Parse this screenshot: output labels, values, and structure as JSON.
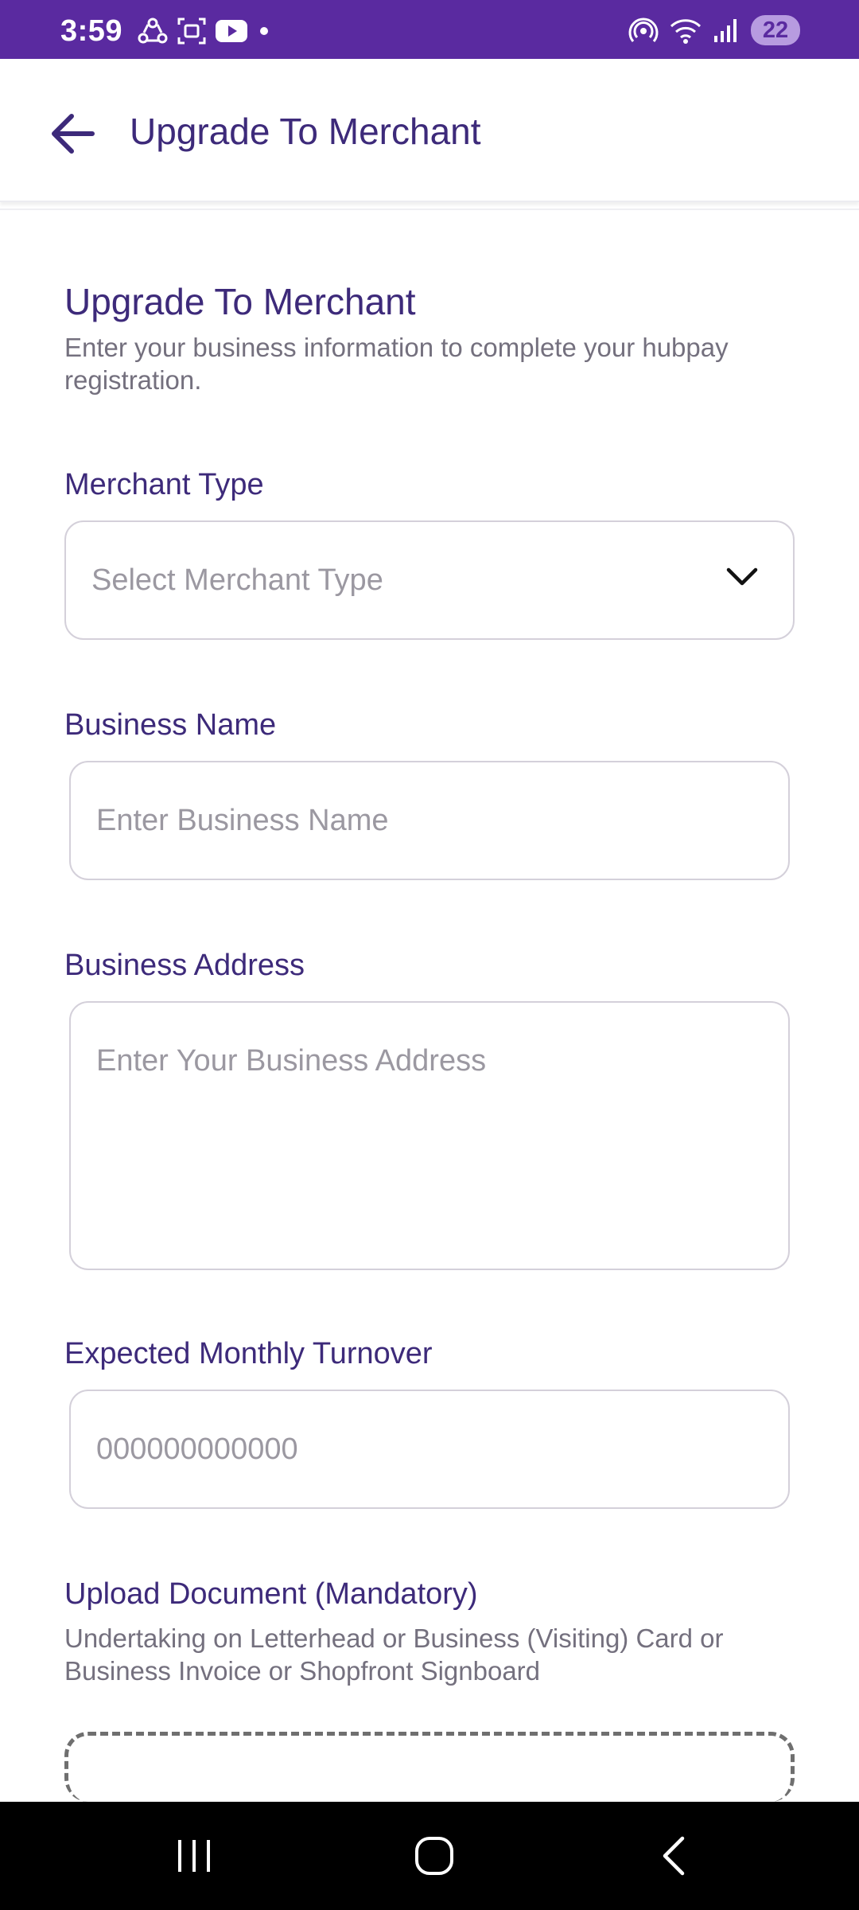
{
  "status_bar": {
    "time": "3:59",
    "battery": "22",
    "left_icons": [
      "sync-icon",
      "screenshot-icon",
      "youtube-icon",
      "dot-icon"
    ],
    "right_icons": [
      "hotspot-icon",
      "wifi-icon",
      "signal-icon",
      "battery-icon"
    ]
  },
  "app_bar": {
    "title": "Upgrade To Merchant",
    "back_icon": "back-arrow-icon"
  },
  "form": {
    "heading": "Upgrade To Merchant",
    "subtitle": "Enter your business information to complete your hubpay registration.",
    "merchant_type": {
      "label": "Merchant Type",
      "placeholder": "Select Merchant Type"
    },
    "business_name": {
      "label": "Business Name",
      "placeholder": "Enter Business Name"
    },
    "business_address": {
      "label": "Business Address",
      "placeholder": "Enter Your Business Address"
    },
    "monthly_turnover": {
      "label": "Expected Monthly Turnover",
      "placeholder": "000000000000"
    },
    "upload": {
      "label": "Upload Document (Mandatory)",
      "description": "Undertaking on Letterhead or Business (Visiting) Card or Business Invoice or Shopfront Signboard"
    }
  },
  "colors": {
    "status_bar": "#5a2aa0",
    "accent_text": "#3d2a7a",
    "muted_text": "#74707e",
    "placeholder": "#9b98a1"
  },
  "nav_bar": {
    "icons": [
      "recents-icon",
      "home-icon",
      "back-icon"
    ]
  }
}
